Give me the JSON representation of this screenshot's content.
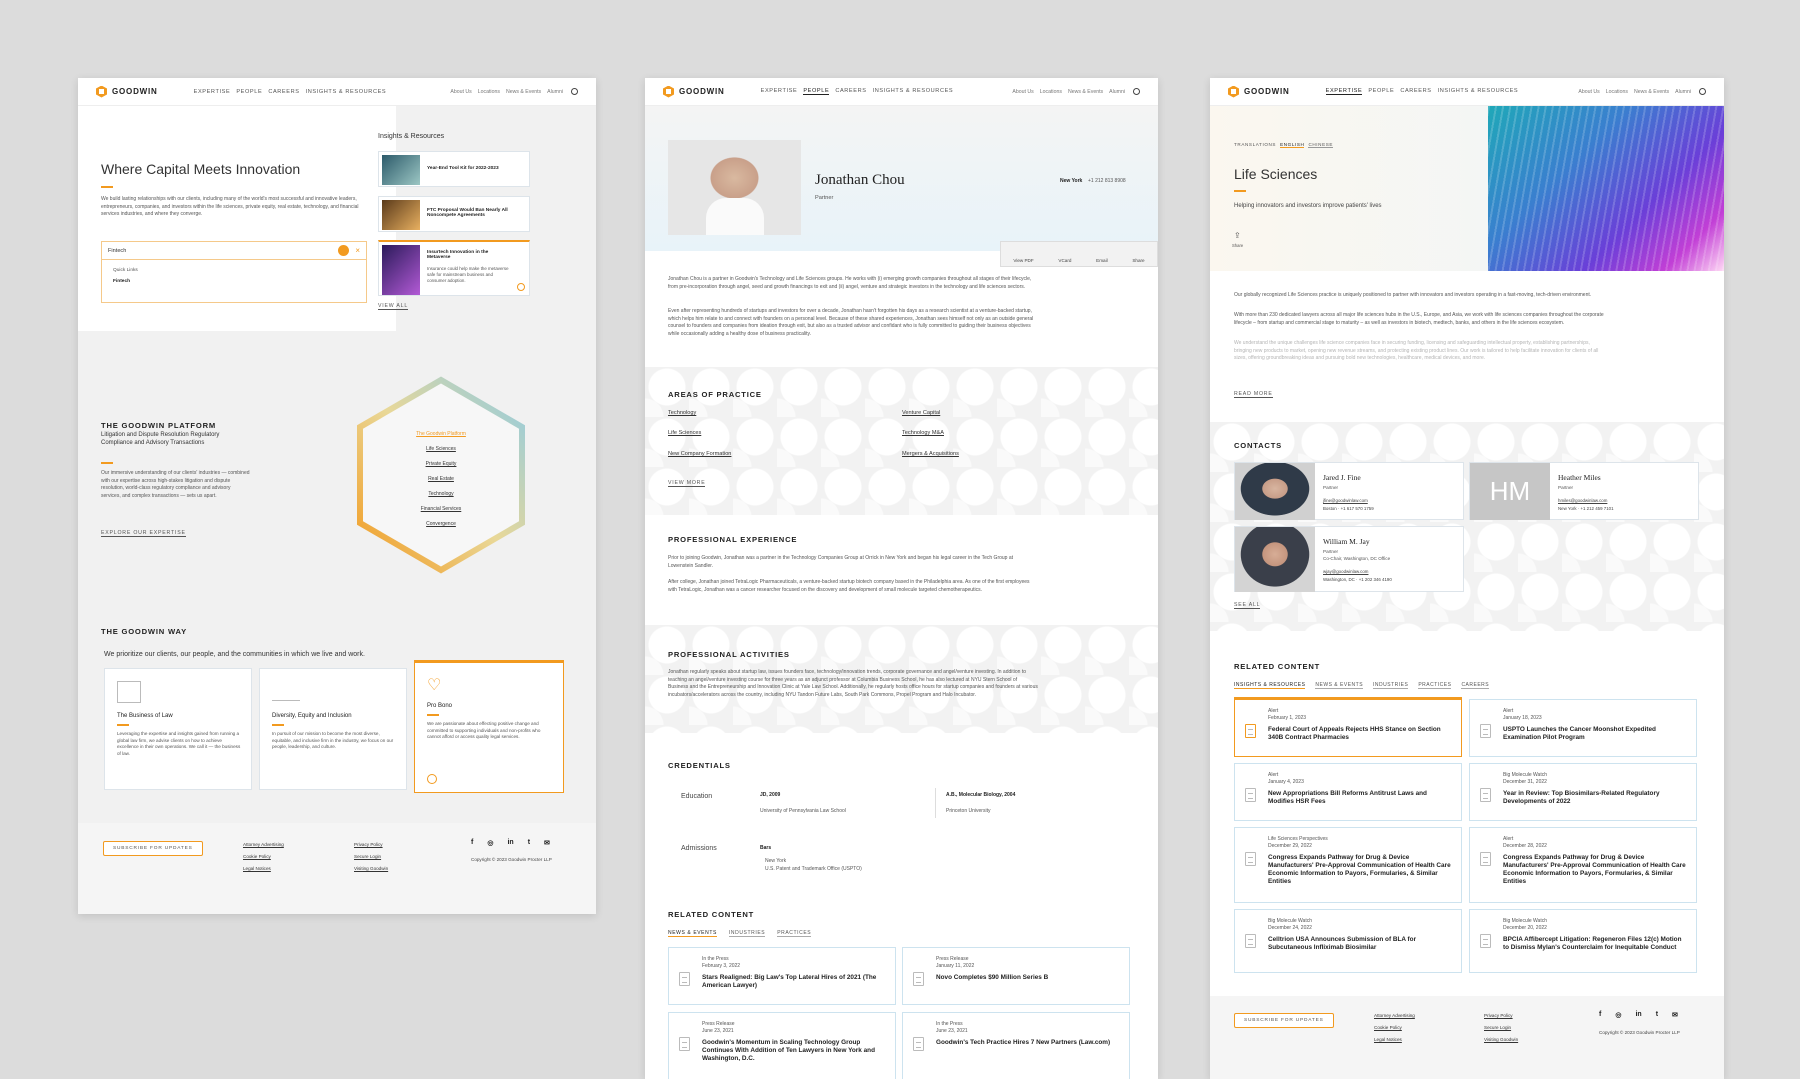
{
  "colors": {
    "accent": "#f29a1f",
    "border": "#cde3ef",
    "background": "#dcdcdc"
  },
  "nav": {
    "logo": "GOODWIN",
    "main": [
      "EXPERTISE",
      "PEOPLE",
      "CAREERS",
      "INSIGHTS & RESOURCES"
    ],
    "secondary": [
      "About Us",
      "Locations",
      "News & Events",
      "Alumni"
    ]
  },
  "home": {
    "hero_title": "Where Capital Meets Innovation",
    "hero_text": "We build lasting relationships with our clients, including many of the world's most successful and innovative leaders, entrepreneurs, companies, and investors within the life sciences, private equity, real estate, technology, and financial services industries, and where they converge.",
    "search_value": "Fintech",
    "quick_links_label": "Quick Links",
    "quick_link": "Fintech",
    "insights_title": "Insights & Resources",
    "insights": [
      {
        "title": "Year-End Tool Kit for 2022-2023"
      },
      {
        "title": "FTC Proposal Would Ban Nearly All Noncompete Agreements"
      },
      {
        "title": "Insurtech Innovation in the Metaverse",
        "text": "Insurance could help make the metaverse safe for mainstream business and consumer adoption."
      }
    ],
    "view_all": "VIEW ALL",
    "platform_title": "THE GOODWIN PLATFORM",
    "platform_sub": "Litigation and Dispute Resolution Regulatory Compliance and Advisory Transactions",
    "platform_text": "Our immersive understanding of our clients' industries — combined with our expertise across high-stakes litigation and dispute resolution, world-class regulatory compliance and advisory services, and complex transactions — sets us apart.",
    "explore": "EXPLORE OUR EXPERTISE",
    "hex_items": [
      "The Goodwin Platform",
      "Life Sciences",
      "Private Equity",
      "Real Estate",
      "Technology",
      "Financial Services",
      "Convergence"
    ],
    "way_title": "THE GOODWIN WAY",
    "way_text": "We prioritize our clients, our people, and the communities in which we live and work.",
    "way_cards": [
      {
        "title": "The Business of Law",
        "text": "Leveraging the expertise and insights gained from running a global law firm, we advise clients on how to achieve excellence in their own operations. We call it — the business of law."
      },
      {
        "title": "Diversity, Equity and Inclusion",
        "text": "In pursuit of our mission to become the most diverse, equitable, and inclusive firm in the industry, we focus on our people, leadership, and culture."
      },
      {
        "title": "Pro Bono",
        "text": "We are passionate about effecting positive change and committed to supporting individuals and non-profits who cannot afford or access quality legal services."
      }
    ]
  },
  "footer": {
    "subscribe": "SUBSCRIBE FOR UPDATES",
    "col1": [
      "Attorney Advertising",
      "Cookie Policy",
      "Legal Notices"
    ],
    "col2": [
      "Privacy Policy",
      "Secure Login",
      "Visiting Goodwin"
    ],
    "social": [
      "f",
      "◎",
      "in",
      "t",
      "✉"
    ],
    "copyright": "Copyright © 2023 Goodwin Procter LLP"
  },
  "profile": {
    "name": "Jonathan Chou",
    "role": "Partner",
    "office": "New York",
    "phone": "+1 212 813 8908",
    "actions": [
      "View PDF",
      "VCard",
      "Email",
      "Share"
    ],
    "bio1": "Jonathan Chou is a partner in Goodwin's Technology and Life Sciences groups. He works with (i) emerging growth companies throughout all stages of their lifecycle, from pre-incorporation through angel, seed and growth financings to exit and (ii) angel, venture and strategic investors in the technology and life sciences sectors.",
    "bio2": "Even after representing hundreds of startups and investors for over a decade, Jonathan hasn't forgotten his days as a research scientist at a venture-backed startup, which helps him relate to and connect with founders on a personal level. Because of these shared experiences, Jonathan sees himself not only as an outside general counsel to founders and companies from ideation through exit, but also as a trusted advisor and confidant who is fully committed to guiding their business objectives while occasionally adding a healthy dose of business practicality.",
    "areas_title": "AREAS OF PRACTICE",
    "areas": [
      "Technology",
      "Venture Capital",
      "Life Sciences",
      "Technology M&A",
      "New Company Formation",
      "Mergers & Acquisitions"
    ],
    "view_more": "VIEW MORE",
    "exp_title": "PROFESSIONAL EXPERIENCE",
    "exp1": "Prior to joining Goodwin, Jonathan was a partner in the Technology Companies Group at Orrick in New York and began his legal career in the Tech Group at Lowenstein Sandler.",
    "exp2": "After college, Jonathan joined TetraLogic Pharmaceuticals, a venture-backed startup biotech company based in the Philadelphia area. As one of the first employees with TetraLogic, Jonathan was a cancer researcher focused on the discovery and development of small molecule targeted chemotherapeutics.",
    "act_title": "PROFESSIONAL ACTIVITIES",
    "act_text": "Jonathan regularly speaks about startup law, issues founders face, technology/innovation trends, corporate governance and angel/venture investing. In addition to teaching an angel/venture investing course for three years as an adjunct professor at Columbia Business School, he has also lectured at NYU Stern School of Business and the Entrepreneurship and Innovation Clinic at Yale Law School. Additionally, he regularly hosts office hours for startup companies and founders at various incubators/accelerators across the country, including NYU Tandon Future Labs, South Park Commons, Propel Program and Halo Incubator.",
    "cred_title": "CREDENTIALS",
    "education_label": "Education",
    "edu": [
      {
        "degree": "JD, 2009",
        "school": "University of Pennsylvania Law School"
      },
      {
        "degree": "A.B., Molecular Biology, 2004",
        "school": "Princeton University"
      }
    ],
    "admissions_label": "Admissions",
    "bars_label": "Bars",
    "bars": [
      "New York",
      "U.S. Patent and Trademark Office (USPTO)"
    ],
    "related_title": "RELATED CONTENT",
    "related_tabs": [
      "NEWS & EVENTS",
      "INDUSTRIES",
      "PRACTICES"
    ],
    "related": [
      {
        "cat": "In the Press",
        "date": "February 3, 2022",
        "title": "Stars Realigned: Big Law's Top Lateral Hires of 2021 (The American Lawyer)"
      },
      {
        "cat": "Press Release",
        "date": "January 11, 2022",
        "title": "Novo Completes $90 Million Series B"
      },
      {
        "cat": "Press Release",
        "date": "June 23, 2021",
        "title": "Goodwin's Momentum in Scaling Technology Group Continues With Addition of Ten Lawyers in New York and Washington, D.C."
      },
      {
        "cat": "In the Press",
        "date": "June 23, 2021",
        "title": "Goodwin's Tech Practice Hires 7 New Partners (Law.com)"
      }
    ]
  },
  "industry": {
    "translations_label": "TRANSLATIONS",
    "translations": [
      "ENGLISH",
      "CHINESE"
    ],
    "title": "Life Sciences",
    "subtitle": "Helping innovators and investors improve patients' lives",
    "share": "Share",
    "p1": "Our globally recognized Life Sciences practice is uniquely positioned to partner with innovators and investors operating in a fast-moving, tech-driven environment.",
    "p2": "With more than 230 dedicated lawyers across all major life sciences hubs in the U.S., Europe, and Asia, we work with life sciences companies throughout the corporate lifecycle – from startup and commercial stage to maturity – as well as investors in biotech, medtech, banks, and others in the life sciences ecosystem.",
    "p3": "We understand the unique challenges life science companies face in securing funding, licensing and safeguarding intellectual property, establishing partnerships, bringing new products to market, opening new revenue streams, and protecting existing product lines. Our work is tailored to help facilitate innovation for clients of all sizes, offering groundbreaking ideas and pursuing bold new technologies, healthcare, medical devices, and more.",
    "read_more": "READ MORE",
    "contacts_title": "CONTACTS",
    "contacts": [
      {
        "name": "Jared J. Fine",
        "role": "Partner",
        "email": "jfine@goodwinlaw.com",
        "phone": "Boston · +1 617 570 1759"
      },
      {
        "name": "Heather Miles",
        "role": "Partner",
        "email": "hmiles@goodwinlaw.com",
        "phone": "New York · +1 212 459 7101",
        "initials": "HM"
      },
      {
        "name": "William M. Jay",
        "role": "Partner",
        "role2": "Co-Chair, Washington, DC Office",
        "email": "wjay@goodwinlaw.com",
        "phone": "Washington, DC · +1 202 346 4190"
      }
    ],
    "see_all": "SEE ALL",
    "related_title": "RELATED CONTENT",
    "related_tabs": [
      "INSIGHTS & RESOURCES",
      "NEWS & EVENTS",
      "INDUSTRIES",
      "PRACTICES",
      "CAREERS"
    ],
    "related": [
      {
        "cat": "Alert",
        "date": "February 1, 2023",
        "title": "Federal Court of Appeals Rejects HHS Stance on Section 340B Contract Pharmacies"
      },
      {
        "cat": "Alert",
        "date": "January 18, 2023",
        "title": "USPTO Launches the Cancer Moonshot Expedited Examination Pilot Program"
      },
      {
        "cat": "Alert",
        "date": "January 4, 2023",
        "title": "New Appropriations Bill Reforms Antitrust Laws and Modifies HSR Fees"
      },
      {
        "cat": "Big Molecule Watch",
        "date": "December 31, 2022",
        "title": "Year in Review: Top Biosimilars-Related Regulatory Developments of 2022"
      },
      {
        "cat": "Life Sciences Perspectives",
        "date": "December 29, 2022",
        "title": "Congress Expands Pathway for Drug & Device Manufacturers' Pre-Approval Communication of Health Care Economic Information to Payors, Formularies, & Similar Entities"
      },
      {
        "cat": "Alert",
        "date": "December 28, 2022",
        "title": "Congress Expands Pathway for Drug & Device Manufacturers' Pre-Approval Communication of Health Care Economic Information to Payors, Formularies, & Similar Entities"
      },
      {
        "cat": "Big Molecule Watch",
        "date": "December 24, 2022",
        "title": "Celltrion USA Announces Submission of BLA for Subcutaneous Infliximab Biosimilar"
      },
      {
        "cat": "Big Molecule Watch",
        "date": "December 20, 2022",
        "title": "BPCIA Affibercept Litigation: Regeneron Files 12(c) Motion to Dismiss Mylan's Counterclaim for Inequitable Conduct"
      }
    ]
  }
}
